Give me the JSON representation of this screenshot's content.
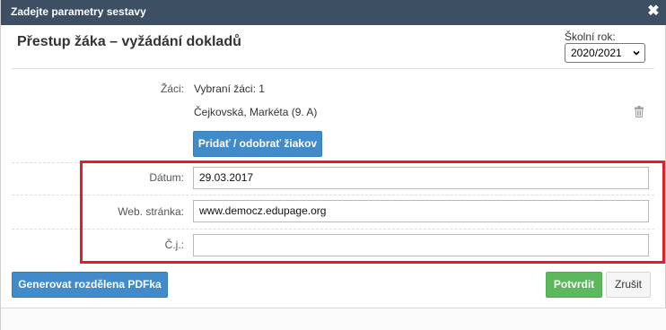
{
  "dialog": {
    "title": "Zadejte parametry sestavy",
    "close_icon": "close-icon",
    "report_title": "Přestup žáka – vyžádání dokladů",
    "school_year": {
      "label": "Školní rok:",
      "selected": "2020/2021"
    }
  },
  "students": {
    "label": "Žáci:",
    "selected_count_text": "Vybraní žáci: 1",
    "items": [
      {
        "name": "Čejkovská, Markéta (9. A)",
        "remove_icon": "trash-icon"
      }
    ],
    "add_remove_button": "Pridať / odobrať žiakov"
  },
  "fields": {
    "date": {
      "label": "Dátum:",
      "value": "29.03.2017"
    },
    "website": {
      "label": "Web. stránka:",
      "value": "www.democz.edupage.org"
    },
    "reference": {
      "label": "Č.j.:",
      "value": ""
    }
  },
  "footer": {
    "generate_split_pdf": "Generovat rozdělena PDFka",
    "confirm": "Potvrdit",
    "cancel": "Zrušit"
  },
  "colors": {
    "titlebar": "#3c4f63",
    "primary_blue": "#428bca",
    "success_green": "#5cb85c",
    "highlight_red": "#e01f26"
  }
}
